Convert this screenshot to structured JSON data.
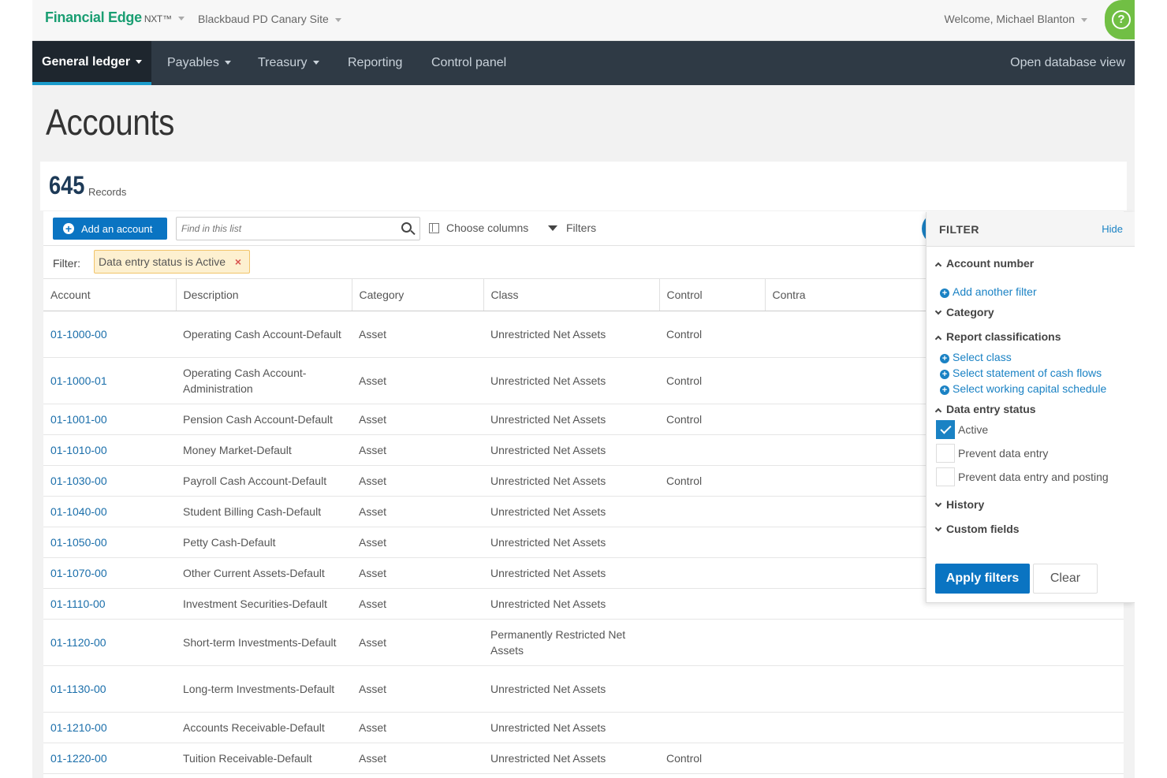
{
  "brand": {
    "name": "Financial Edge",
    "suffix": "NXT™"
  },
  "site": "Blackbaud PD Canary Site",
  "welcome": "Welcome, Michael Blanton",
  "help_icon": "?",
  "nav": {
    "items": [
      "General ledger",
      "Payables",
      "Treasury",
      "Reporting",
      "Control panel"
    ],
    "right": "Open database view"
  },
  "page_title": "Accounts",
  "records": {
    "count": "645",
    "label": "Records"
  },
  "toolbar": {
    "add_label": "Add an account",
    "search_placeholder": "Find in this list",
    "choose_columns": "Choose columns",
    "filters": "Filters"
  },
  "filterbar": {
    "label": "Filter:",
    "chip": "Data entry status is Active",
    "chip_remove": "×"
  },
  "table": {
    "columns": [
      "Account",
      "Description",
      "Category",
      "Class",
      "Control",
      "Contra"
    ],
    "rows": [
      [
        "01-1000-00",
        "Operating Cash Account-Default",
        "Asset",
        "Unrestricted Net Assets",
        "Control",
        ""
      ],
      [
        "01-1000-01",
        "Operating Cash Account-Administration",
        "Asset",
        "Unrestricted Net Assets",
        "Control",
        ""
      ],
      [
        "01-1001-00",
        "Pension Cash Account-Default",
        "Asset",
        "Unrestricted Net Assets",
        "Control",
        ""
      ],
      [
        "01-1010-00",
        "Money Market-Default",
        "Asset",
        "Unrestricted Net Assets",
        "",
        ""
      ],
      [
        "01-1030-00",
        "Payroll Cash Account-Default",
        "Asset",
        "Unrestricted Net Assets",
        "Control",
        ""
      ],
      [
        "01-1040-00",
        "Student Billing Cash-Default",
        "Asset",
        "Unrestricted Net Assets",
        "",
        ""
      ],
      [
        "01-1050-00",
        "Petty Cash-Default",
        "Asset",
        "Unrestricted Net Assets",
        "",
        ""
      ],
      [
        "01-1070-00",
        "Other Current Assets-Default",
        "Asset",
        "Unrestricted Net Assets",
        "",
        ""
      ],
      [
        "01-1110-00",
        "Investment Securities-Default",
        "Asset",
        "Unrestricted Net Assets",
        "",
        ""
      ],
      [
        "01-1120-00",
        "Short-term Investments-Default",
        "Asset",
        "Permanently Restricted Net Assets",
        "",
        ""
      ],
      [
        "01-1130-00",
        "Long-term Investments-Default",
        "Asset",
        "Unrestricted Net Assets",
        "",
        ""
      ],
      [
        "01-1210-00",
        "Accounts Receivable-Default",
        "Asset",
        "Unrestricted Net Assets",
        "",
        ""
      ],
      [
        "01-1220-00",
        "Tuition Receivable-Default",
        "Asset",
        "Unrestricted Net Assets",
        "Control",
        ""
      ]
    ]
  },
  "filter_panel": {
    "title": "FILTER",
    "hide": "Hide",
    "account_number": "Account number",
    "add_another_filter": "Add another filter",
    "category": "Category",
    "report_classifications": "Report classifications",
    "select_class": "Select class",
    "select_cash_flows": "Select statement of cash flows",
    "select_working_capital": "Select working capital schedule",
    "data_entry_status": "Data entry status",
    "status_options": [
      {
        "label": "Active",
        "checked": true
      },
      {
        "label": "Prevent data entry",
        "checked": false
      },
      {
        "label": "Prevent data entry and posting",
        "checked": false
      }
    ],
    "history": "History",
    "custom_fields": "Custom fields",
    "apply": "Apply filters",
    "clear": "Clear"
  },
  "colors": {
    "brand": "#1a9e72",
    "nav_bg": "#2f3a45",
    "primary": "#0a74c2",
    "link": "#1a6eaa",
    "help": "#71bf44"
  }
}
